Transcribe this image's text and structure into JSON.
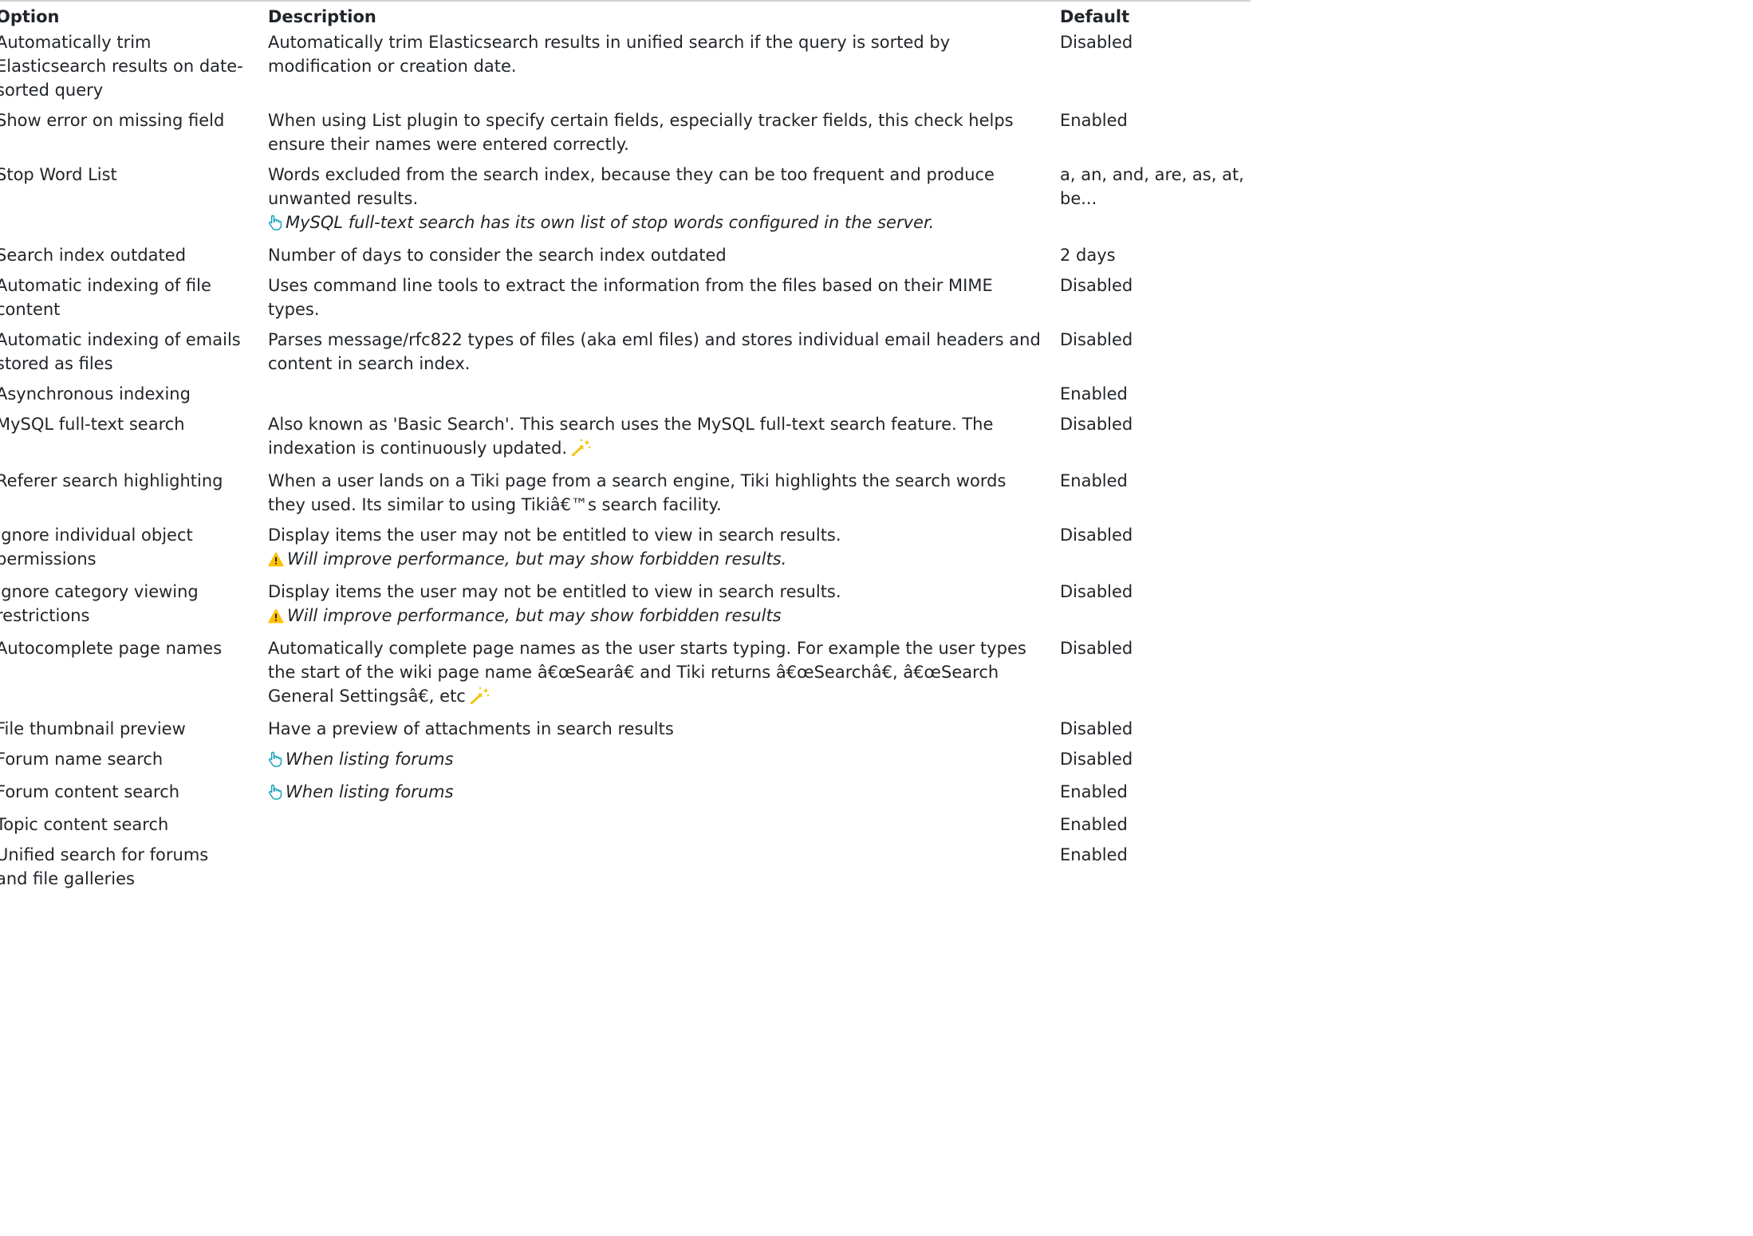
{
  "headers": {
    "option": "Option",
    "description": "Description",
    "default": "Default"
  },
  "rows": [
    {
      "option": "Automatically trim Elasticsearch results on date-sorted query",
      "description": "Automatically trim Elasticsearch results in unified search if the query is sorted by modification or creation date.",
      "default": "Disabled"
    },
    {
      "option": "Show error on missing field",
      "description": "When using List plugin to specify certain fields, especially tracker fields, this check helps ensure their names were entered correctly.",
      "default": "Enabled"
    },
    {
      "option": "Stop Word List",
      "description": "Words excluded from the search index, because they can be too frequent and produce unwanted results.",
      "note": "MySQL full-text search has its own list of stop words configured in the server.",
      "note_icon": "hand-pointer-icon",
      "default": "a, an, and, are, as, at, be..."
    },
    {
      "option": "Search index outdated",
      "description": "Number of days to consider the search index outdated",
      "default": "2 days"
    },
    {
      "option": "Automatic indexing of file content",
      "description": "Uses command line tools to extract the information from the files based on their MIME types.",
      "default": "Disabled"
    },
    {
      "option": "Automatic indexing of emails stored as files",
      "description": "Parses message/rfc822 types of files (aka eml files) and stores individual email headers and content in search index.",
      "default": "Disabled"
    },
    {
      "option": "Asynchronous indexing",
      "description": "",
      "default": "Enabled"
    },
    {
      "option": "MySQL full-text search",
      "description": "Also known as 'Basic Search'. This search uses the MySQL full-text search feature. The indexation is continuously updated.",
      "trail_icon": "magic-wand-icon",
      "default": "Disabled"
    },
    {
      "option": "Referer search highlighting",
      "description": "When a user lands on a Tiki page from a search engine, Tiki highlights the search words they used. Its similar to using Tikiâ€™s search facility.",
      "default": "Enabled"
    },
    {
      "option": "Ignore individual object permissions",
      "description": "Display items the user may not be entitled to view in search results.",
      "note": "Will improve performance, but may show forbidden results.",
      "note_icon": "warning-icon",
      "default": "Disabled"
    },
    {
      "option": "Ignore category viewing restrictions",
      "description": "Display items the user may not be entitled to view in search results.",
      "note": "Will improve performance, but may show forbidden results",
      "note_icon": "warning-icon",
      "default": "Disabled"
    },
    {
      "option": "Autocomplete page names",
      "description": "Automatically complete page names as the user starts typing. For example the user types the start of the wiki page name â€œSearâ€ and Tiki returns â€œSearchâ€, â€œSearch General Settingsâ€, etc",
      "trail_icon": "magic-wand-icon",
      "default": "Disabled"
    },
    {
      "option": "File thumbnail preview",
      "description": "Have a preview of attachments in search results",
      "default": "Disabled"
    },
    {
      "option": "Forum name search",
      "description": "",
      "note": "When listing forums",
      "note_icon": "hand-pointer-icon",
      "default": "Disabled"
    },
    {
      "option": "Forum content search",
      "description": "",
      "note": "When listing forums",
      "note_icon": "hand-pointer-icon",
      "default": "Enabled"
    },
    {
      "option": "Topic content search",
      "description": "",
      "default": "Enabled"
    },
    {
      "option": "Unified search for forums and file galleries",
      "description": "",
      "default": "Enabled"
    }
  ],
  "colors": {
    "text": "#212529",
    "info_icon": "#17a2b8",
    "warning_icon": "#ffc107",
    "wand_icon": "#f5c518",
    "rule": "#cfd3d6"
  }
}
